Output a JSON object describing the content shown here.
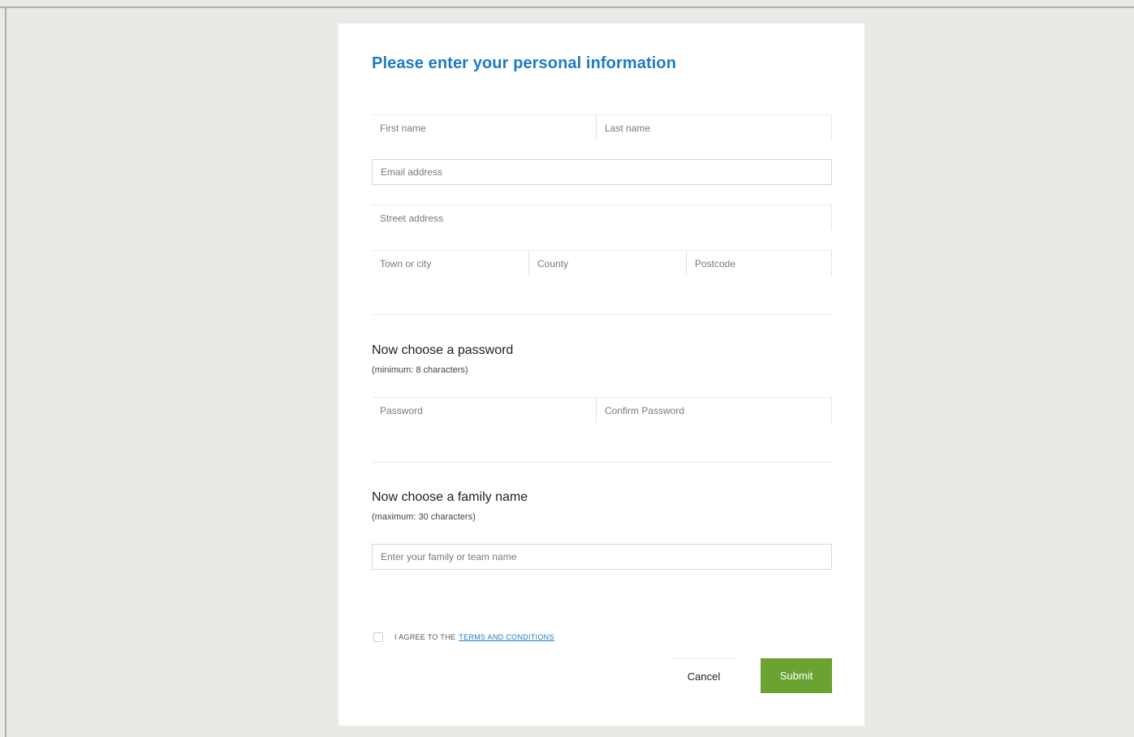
{
  "form": {
    "title": "Please enter your personal information",
    "personal": {
      "first_name_placeholder": "First name",
      "last_name_placeholder": "Last name",
      "email_placeholder": "Email address",
      "street_placeholder": "Street address",
      "town_placeholder": "Town or city",
      "county_placeholder": "County",
      "postcode_placeholder": "Postcode"
    },
    "password_section": {
      "heading": "Now choose a password",
      "note": "(minimum: 8 characters)",
      "password_placeholder": "Password",
      "confirm_placeholder": "Confirm Password"
    },
    "family_section": {
      "heading": "Now choose a family name",
      "note": "(maximum: 30 characters)",
      "family_placeholder": "Enter your family or team name"
    },
    "agreement": {
      "text": "I AGREE TO THE",
      "link_text": "TERMS AND CONDITIONS"
    },
    "actions": {
      "cancel_label": "Cancel",
      "submit_label": "Submit"
    }
  }
}
